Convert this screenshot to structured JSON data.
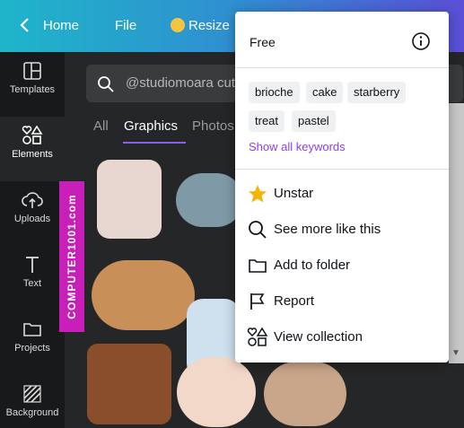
{
  "topbar": {
    "home": "Home",
    "file": "File",
    "resize": "Resize"
  },
  "rail": [
    {
      "label": "Templates"
    },
    {
      "label": "Elements"
    },
    {
      "label": "Uploads"
    },
    {
      "label": "Text"
    },
    {
      "label": "Projects"
    },
    {
      "label": "Background"
    }
  ],
  "search": {
    "value": "@studiomoara cut"
  },
  "tabs": [
    "All",
    "Graphics",
    "Photos"
  ],
  "watermark": "COMPUTER1001.com",
  "popup": {
    "license": "Free",
    "keywords": [
      "brioche",
      "cake",
      "starberry",
      "treat",
      "pastel"
    ],
    "show_all": "Show all keywords",
    "menu": [
      {
        "label": "Unstar",
        "icon": "star-icon"
      },
      {
        "label": "See more like this",
        "icon": "search-icon"
      },
      {
        "label": "Add to folder",
        "icon": "folder-icon"
      },
      {
        "label": "Report",
        "icon": "flag-icon"
      },
      {
        "label": "View collection",
        "icon": "collection-icon"
      }
    ]
  },
  "colors": {
    "accent": "#8b3dff",
    "watermark": "#c81fb8",
    "star": "#f5b400"
  }
}
